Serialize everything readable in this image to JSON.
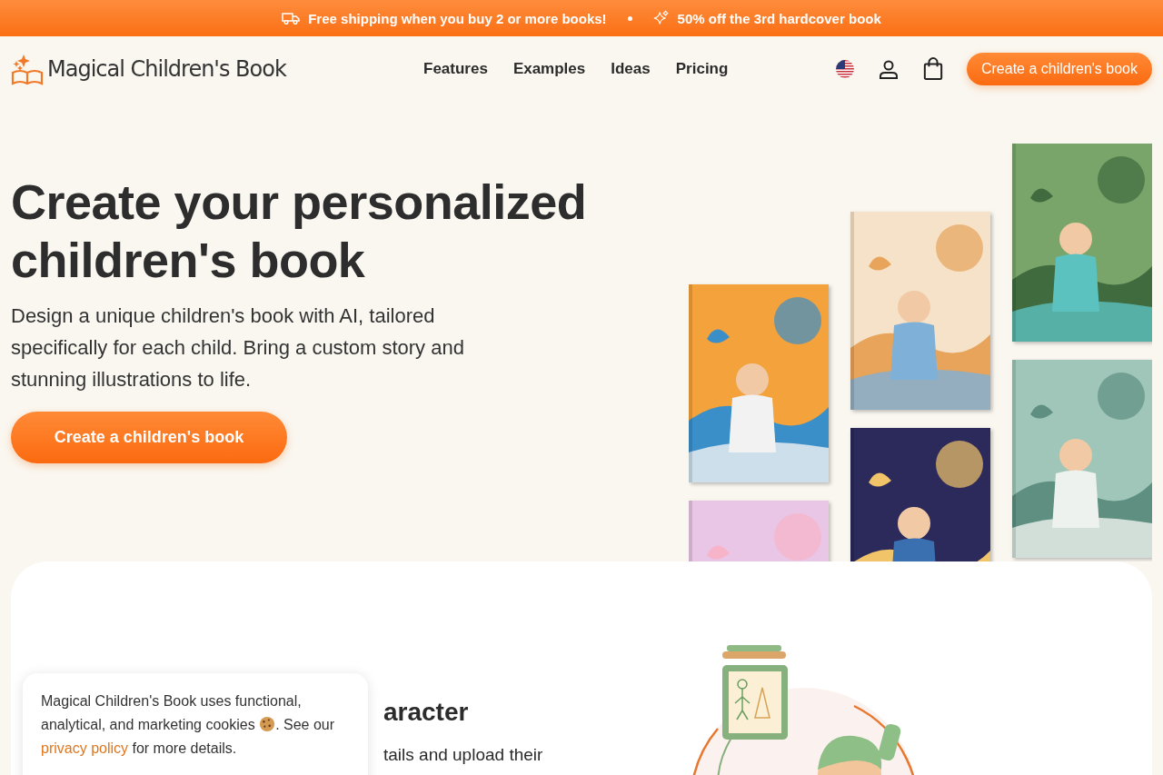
{
  "promo_bar": {
    "items": [
      "Free shipping when you buy 2 or more books!",
      "50% off the 3rd hardcover book"
    ]
  },
  "header": {
    "logo": "Magical Children's Book",
    "nav": [
      "Features",
      "Examples",
      "Ideas",
      "Pricing"
    ],
    "cta": "Create a children's book"
  },
  "hero": {
    "title": "Create your personalized children's book",
    "subtitle": "Design a unique children's book with AI, tailored specifically for each child. Bring a custom story and stunning illustrations to life.",
    "cta": "Create a children's book"
  },
  "feature": {
    "heading": "aracter",
    "text": "tails and upload their"
  },
  "cookie_banner": {
    "text": "Magical Children's Book uses functional, analytical, and marketing cookies",
    "text_after_icon": ". See our",
    "link": "privacy policy",
    "text_end": "for more details."
  }
}
